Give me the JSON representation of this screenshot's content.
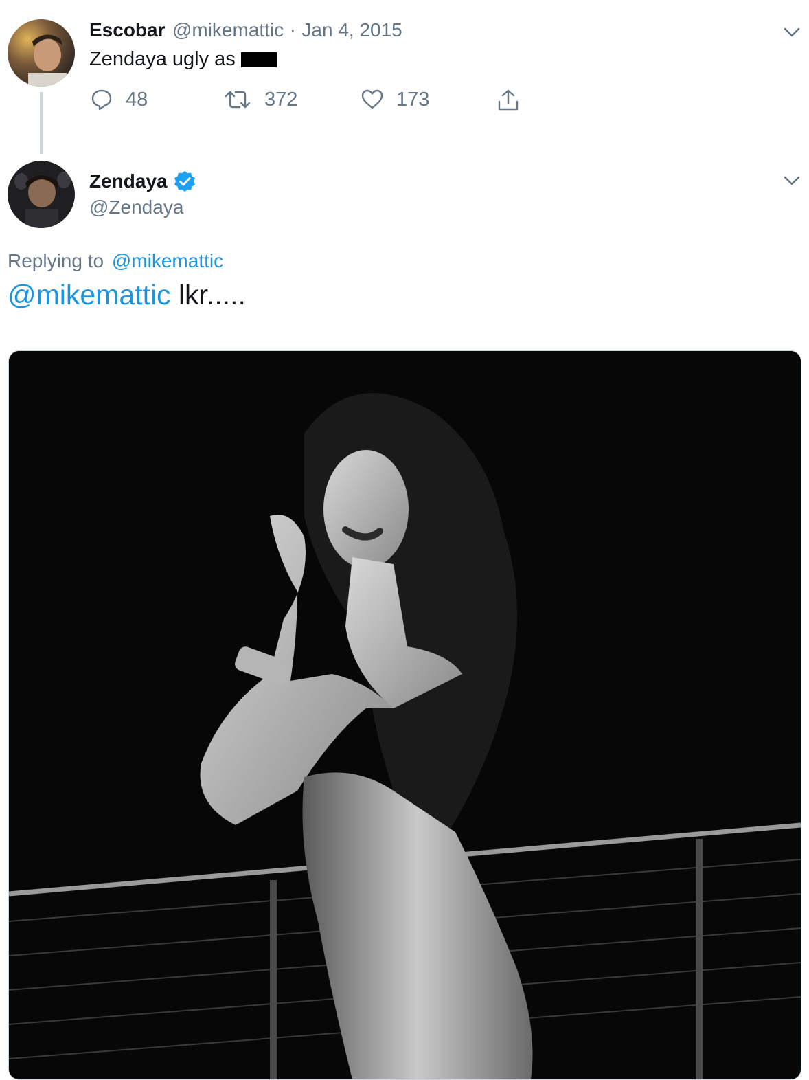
{
  "tweet1": {
    "name": "Escobar",
    "handle": "@mikemattic",
    "separator": "·",
    "date": "Jan 4, 2015",
    "text": "Zendaya ugly as",
    "actions": {
      "replies": "48",
      "retweets": "372",
      "likes": "173"
    }
  },
  "tweet2": {
    "name": "Zendaya",
    "handle": "@Zendaya",
    "replying_label": "Replying to",
    "replying_handle": "@mikemattic",
    "mention": "@mikemattic",
    "text": "lkr....."
  },
  "icons": {
    "reply": "reply-icon",
    "retweet": "retweet-icon",
    "like": "heart-icon",
    "share": "share-icon",
    "verified": "verified-badge-icon",
    "more": "chevron-down-icon"
  },
  "colors": {
    "link": "#1b95e0",
    "verified": "#1da1f2",
    "muted": "#657786",
    "text": "#14171a"
  }
}
